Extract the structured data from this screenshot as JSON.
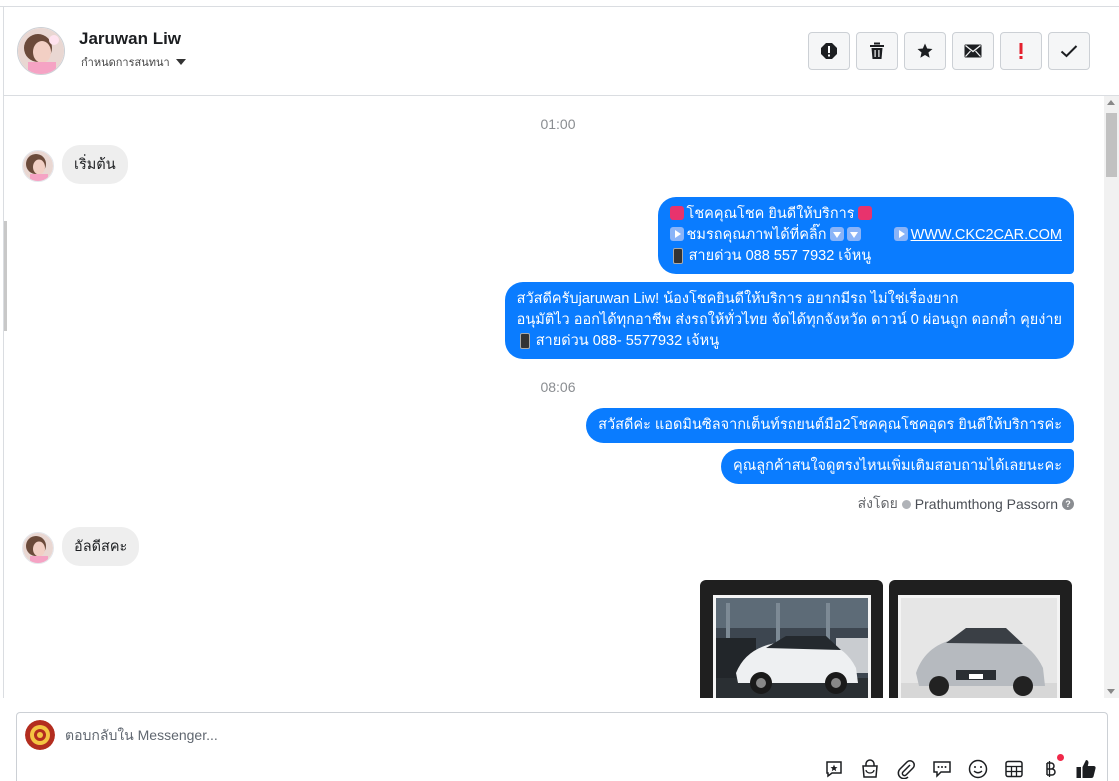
{
  "header": {
    "contact_name": "Jaruwan Liw",
    "assign_label": "กำหนดการสนทนา",
    "actions": [
      {
        "name": "report-spam-button",
        "icon": "alert-circle-icon"
      },
      {
        "name": "delete-button",
        "icon": "trash-icon"
      },
      {
        "name": "star-button",
        "icon": "star-icon"
      },
      {
        "name": "mark-unread-button",
        "icon": "envelope-icon"
      },
      {
        "name": "follow-up-button",
        "icon": "exclamation-icon"
      },
      {
        "name": "mark-done-button",
        "icon": "check-icon"
      }
    ]
  },
  "thread": {
    "timestamp_1": "01:00",
    "incoming_1": "เริ่มต้น",
    "out_1": {
      "line1": "โชคคุณโชค ยินดีให้บริการ",
      "line2_text": "ชมรถคุณภาพได้ที่คลิ๊ก",
      "line2_link": "WWW.CKC2CAR.COM",
      "line3": "สายด่วน 088 557 7932 เจ้หนู"
    },
    "out_2": {
      "line1": "สวัสดีครับjaruwan Liw! น้องโชคยินดีให้บริการ อยากมีรถ ไม่ใช่เรื่องยาก",
      "line2": "อนุมัติไว ออกได้ทุกอาชีพ ส่งรถให้ทั่วไทย จัดได้ทุกจังหวัด ดาวน์ 0  ผ่อนถูก ดอกต่ำ คุยง่าย",
      "line3": "สายด่วน 088- 5577932 เจ้หนู"
    },
    "timestamp_2": "08:06",
    "out_3": "สวัสดีค่ะ แอดมินซิลจากเต็นท์รถยนต์มือ2โชคคุณโชคอุดร ยินดีให้บริการค่ะ",
    "out_4": "คุณลูกค้าสนใจดูตรงไหนเพิ่มเติมสอบถามได้เลยนะคะ",
    "sent_by_label": "ส่งโดย",
    "sent_by_agent": "Prathumthong Passorn",
    "incoming_2": "อัลดีสคะ"
  },
  "composer": {
    "placeholder": "ตอบกลับใน Messenger...",
    "tools": [
      "saved-reply-icon",
      "shopping-bag-icon",
      "paperclip-icon",
      "chat-bubbles-icon",
      "smiley-icon",
      "table-icon",
      "baht-icon",
      "thumbs-up-icon"
    ]
  }
}
